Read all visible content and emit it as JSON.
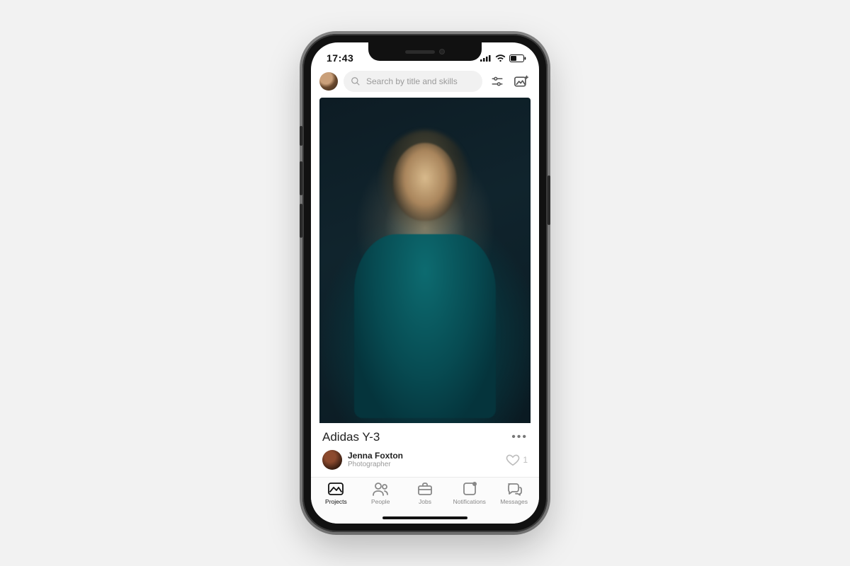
{
  "statusbar": {
    "time": "17:43"
  },
  "header": {
    "search_placeholder": "Search by title and skills"
  },
  "post": {
    "title": "Adidas Y-3",
    "author_name": "Jenna Foxton",
    "author_role": "Photographer",
    "likes": "1"
  },
  "tabs": {
    "projects": "Projects",
    "people": "People",
    "jobs": "Jobs",
    "notifications": "Notifications",
    "messages": "Messages"
  }
}
